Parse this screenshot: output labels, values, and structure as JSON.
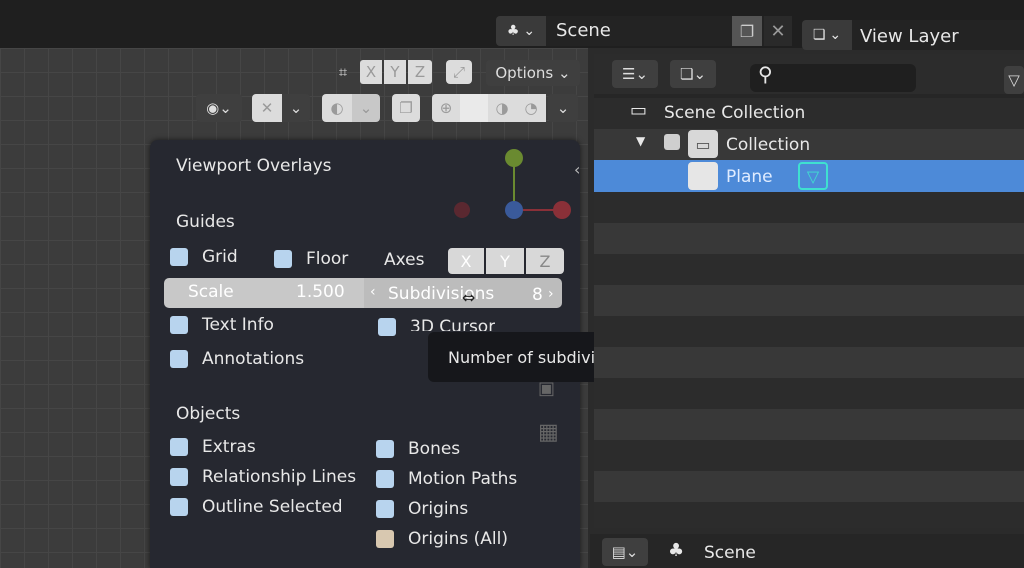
{
  "topbar": {
    "scene_label": "Scene",
    "view_layer_label": "View Layer",
    "copy_icon": "copy-icon",
    "close_icon": "close-icon"
  },
  "viewport_header": {
    "axes": [
      "X",
      "Y",
      "Z"
    ],
    "options_label": "Options"
  },
  "overlays": {
    "title": "Viewport Overlays",
    "guides_heading": "Guides",
    "grid_label": "Grid",
    "floor_label": "Floor",
    "axes_label": "Axes",
    "axes_buttons": [
      "X",
      "Y",
      "Z"
    ],
    "scale_label": "Scale",
    "scale_value": "1.500",
    "subdivisions_label": "Subdivisions",
    "subdivisions_value": "8",
    "text_info_label": "Text Info",
    "cursor_label": "3D Cursor",
    "annotations_label": "Annotations",
    "objects_heading": "Objects",
    "extras_label": "Extras",
    "bones_label": "Bones",
    "relationship_lines_label": "Relationship Lines",
    "motion_paths_label": "Motion Paths",
    "outline_selected_label": "Outline Selected",
    "origins_label": "Origins",
    "origins_all_label": "Origins (All)"
  },
  "tooltip": {
    "text": "Number of subdivisions between grid lines."
  },
  "outliner": {
    "scene_collection": "Scene Collection",
    "collection": "Collection",
    "plane": "Plane"
  },
  "bottom": {
    "scene_label": "Scene"
  },
  "colors": {
    "accent_selected": "#4d8ad8",
    "checkbox": "#b8d4ee"
  }
}
